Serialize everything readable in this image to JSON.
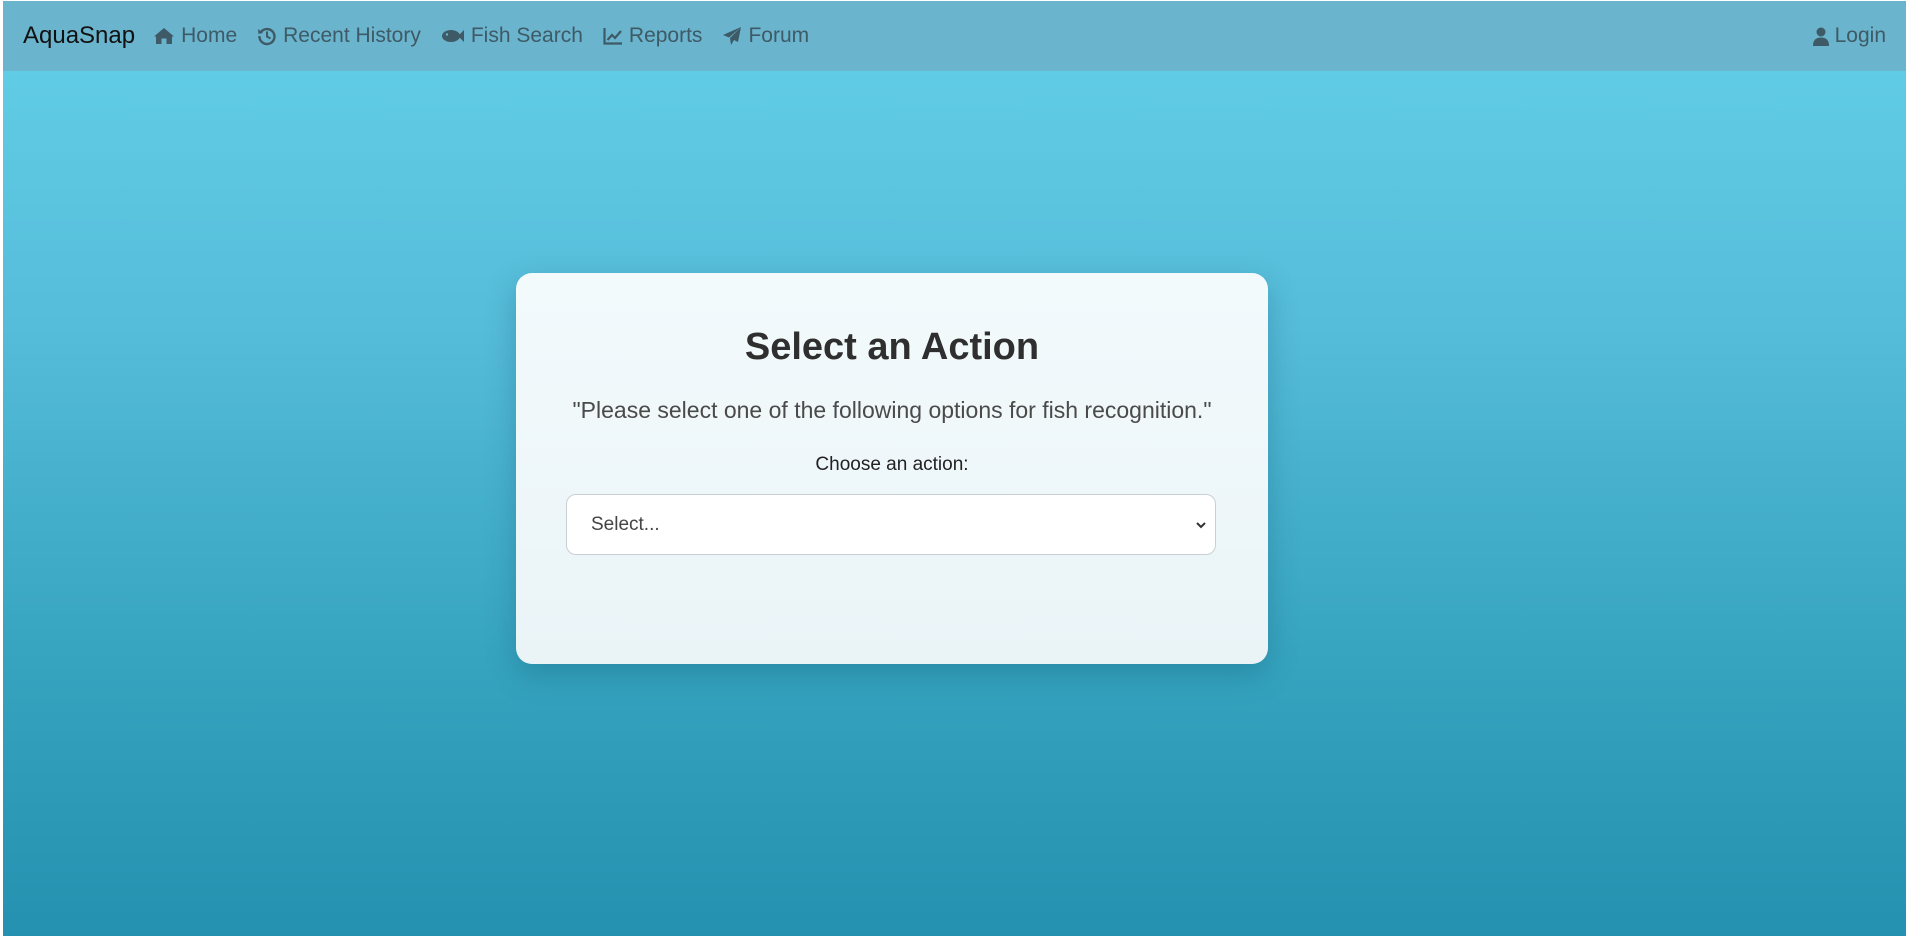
{
  "navbar": {
    "brand": "AquaSnap",
    "items": [
      {
        "label": "Home",
        "icon": "home-icon"
      },
      {
        "label": "Recent History",
        "icon": "history-icon"
      },
      {
        "label": "Fish Search",
        "icon": "fish-icon"
      },
      {
        "label": "Reports",
        "icon": "chart-line-icon"
      },
      {
        "label": "Forum",
        "icon": "paper-plane-icon"
      }
    ],
    "login": {
      "label": "Login",
      "icon": "user-icon"
    }
  },
  "card": {
    "title": "Select an Action",
    "subtitle": "\"Please select one of the following options for fish recognition.\"",
    "label": "Choose an action:",
    "select": {
      "value": "Select..."
    }
  },
  "colors": {
    "navbar": "#6bb4cd",
    "background_top": "#64d0e8",
    "background_bottom": "#2491b0",
    "card": "#f3fafc",
    "nav_text": "#3e5a66"
  }
}
